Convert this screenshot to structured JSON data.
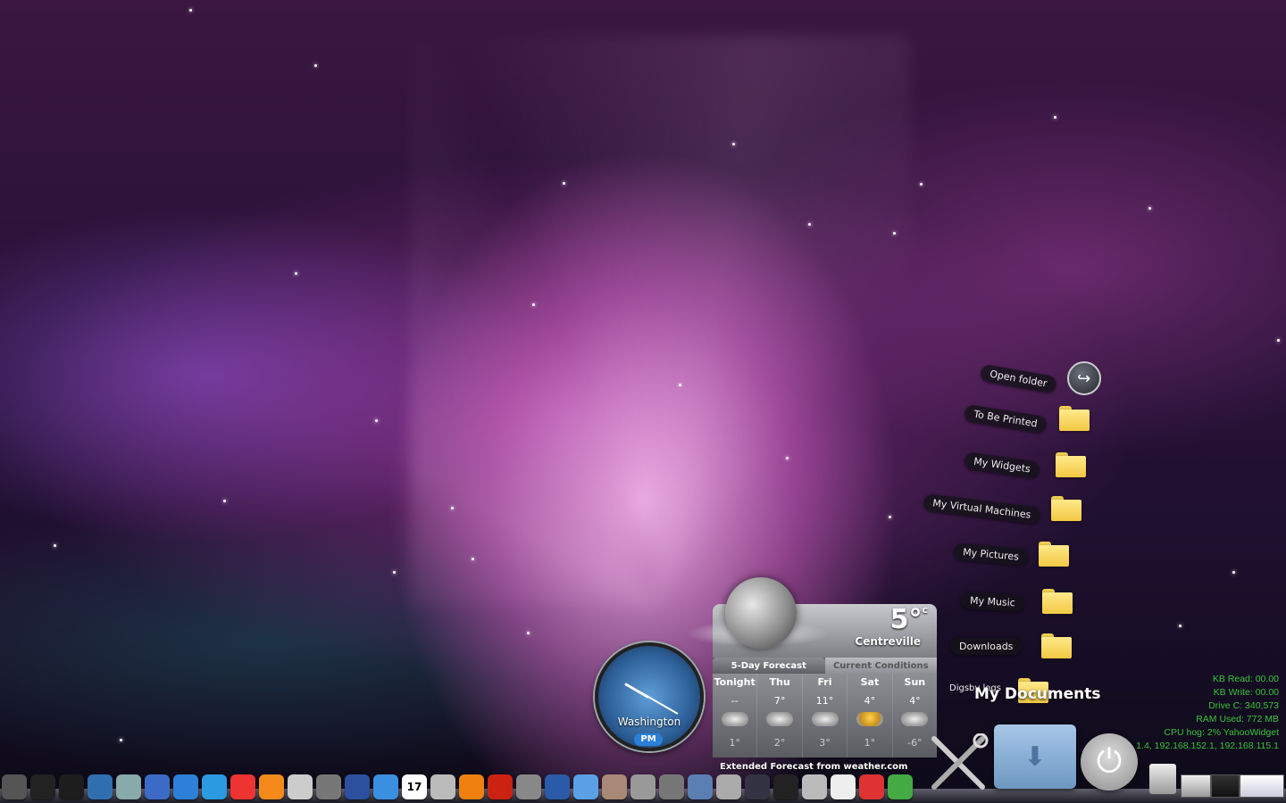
{
  "desktop": {
    "stack_items": [
      {
        "label": "Open folder",
        "icon": "open-arrow-icon"
      },
      {
        "label": "To Be Printed",
        "icon": "folder-icon"
      },
      {
        "label": "My Widgets",
        "icon": "folder-icon"
      },
      {
        "label": "My Virtual Machines",
        "icon": "folder-icon"
      },
      {
        "label": "My Pictures",
        "icon": "pictures-folder-icon"
      },
      {
        "label": "My Music",
        "icon": "music-folder-icon"
      },
      {
        "label": "Downloads",
        "icon": "folder-icon"
      },
      {
        "label": "Digsby logs",
        "icon": "folder-icon"
      }
    ],
    "stack_title": "My Documents"
  },
  "weather": {
    "temperature": "5°",
    "unit": "c",
    "city": "Centreville",
    "tabs": [
      "5-Day Forecast",
      "Current Conditions"
    ],
    "days": [
      {
        "name": "Tonight",
        "high": "--",
        "low": "1°"
      },
      {
        "name": "Thu",
        "high": "7°",
        "low": "2°"
      },
      {
        "name": "Fri",
        "high": "11°",
        "low": "3°"
      },
      {
        "name": "Sat",
        "high": "4°",
        "low": "1°"
      },
      {
        "name": "Sun",
        "high": "4°",
        "low": "-6°"
      }
    ],
    "footer": "Extended Forecast from weather.com"
  },
  "clock": {
    "city": "Washington",
    "ampm": "PM"
  },
  "sysinfo": {
    "lines": [
      "KB Read: 00.00",
      "KB Write: 00.00",
      "Drive C: 340,573",
      "RAM Used: 772 MB",
      "CPU hog: 2% YahooWidget",
      "1.4, 192.168.152.1, 192.168.115.1"
    ]
  },
  "dock": {
    "icons": [
      "settings-icon",
      "terminal-icon",
      "terminal-icon",
      "browser-icon",
      "globe-icon",
      "network-icon",
      "ie-icon",
      "safari-icon",
      "chrome-icon",
      "firefox-icon",
      "home-icon",
      "camera-icon",
      "remote-icon",
      "chat-icon",
      "calendar-icon",
      "dvd-icon",
      "vlc-icon",
      "music-icon",
      "gimp-icon",
      "globe-icon",
      "itunes-icon",
      "photos-icon",
      "preferences-icon",
      "tools-icon",
      "computer-icon",
      "printer-icon",
      "time-machine-icon",
      "x11-icon",
      "mail-icon",
      "notes-icon",
      "preview-icon",
      "arrow-icon"
    ],
    "calendar_day": "17"
  },
  "colors": {
    "sysinfo": "#37c437",
    "accent": "#2c7fd6"
  }
}
